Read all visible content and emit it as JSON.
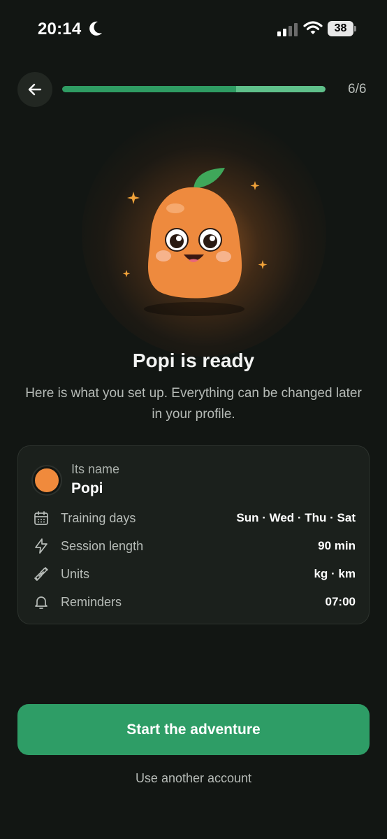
{
  "status_bar": {
    "time": "20:14",
    "battery": "38",
    "icons": [
      "moon-icon",
      "signal-icon",
      "wifi-icon",
      "battery-icon"
    ]
  },
  "header": {
    "back_icon": "arrow-left-icon",
    "progress_fraction": 0.66,
    "progress_label": "6/6"
  },
  "hero": {
    "title": "Popi is ready",
    "subtitle": "Here is what you set up. Everything can be changed later in your profile."
  },
  "summary": {
    "name_label": "Its name",
    "name_value": "Popi",
    "avatar_color": "#f08a3c",
    "rows": [
      {
        "icon": "calendar-icon",
        "label": "Training days",
        "value": "Sun · Wed · Thu · Sat"
      },
      {
        "icon": "lightning-icon",
        "label": "Session length",
        "value": "90 min"
      },
      {
        "icon": "dumbbell-icon",
        "label": "Units",
        "value": "kg · km"
      },
      {
        "icon": "bell-icon",
        "label": "Reminders",
        "value": "07:00"
      }
    ]
  },
  "actions": {
    "primary": "Start the adventure",
    "secondary": "Use another account"
  },
  "colors": {
    "background": "#121613",
    "accent_green": "#2e9d66",
    "mascot_orange": "#f08a3c"
  }
}
